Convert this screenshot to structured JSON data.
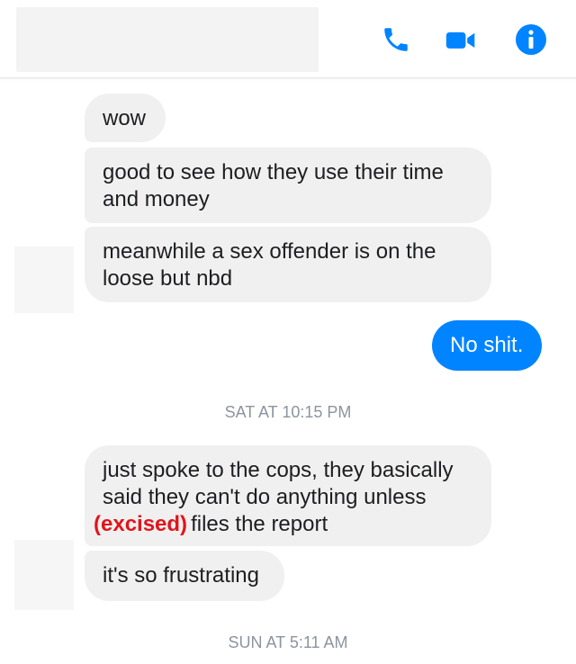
{
  "colors": {
    "accent": "#0084ff",
    "incoming_bubble": "#f1f0f0",
    "redacted_text": "#e2141b",
    "timestamp_text": "#8d949e"
  },
  "header": {
    "icons": [
      "phone-icon",
      "video-camera-icon",
      "info-icon"
    ]
  },
  "messages": [
    {
      "sender": "them",
      "lines": [
        "wow"
      ]
    },
    {
      "sender": "them",
      "lines": [
        "good to see how they use their time",
        "and money"
      ]
    },
    {
      "sender": "them",
      "lines": [
        "meanwhile a sex offender is on the",
        "loose but nbd"
      ]
    },
    {
      "sender": "me",
      "lines": [
        "No shit."
      ]
    },
    {
      "type": "timestamp",
      "text": "SAT AT 10:15 PM"
    },
    {
      "sender": "them",
      "lines": [
        "just spoke to the cops, they basically",
        "said they can't do anything unless"
      ],
      "line3_redacted": "(excised)",
      "line3_rest": "files the report"
    },
    {
      "sender": "them",
      "lines": [
        "it's so frustrating"
      ]
    },
    {
      "type": "timestamp",
      "text": "SUN AT 5:11 AM"
    }
  ]
}
